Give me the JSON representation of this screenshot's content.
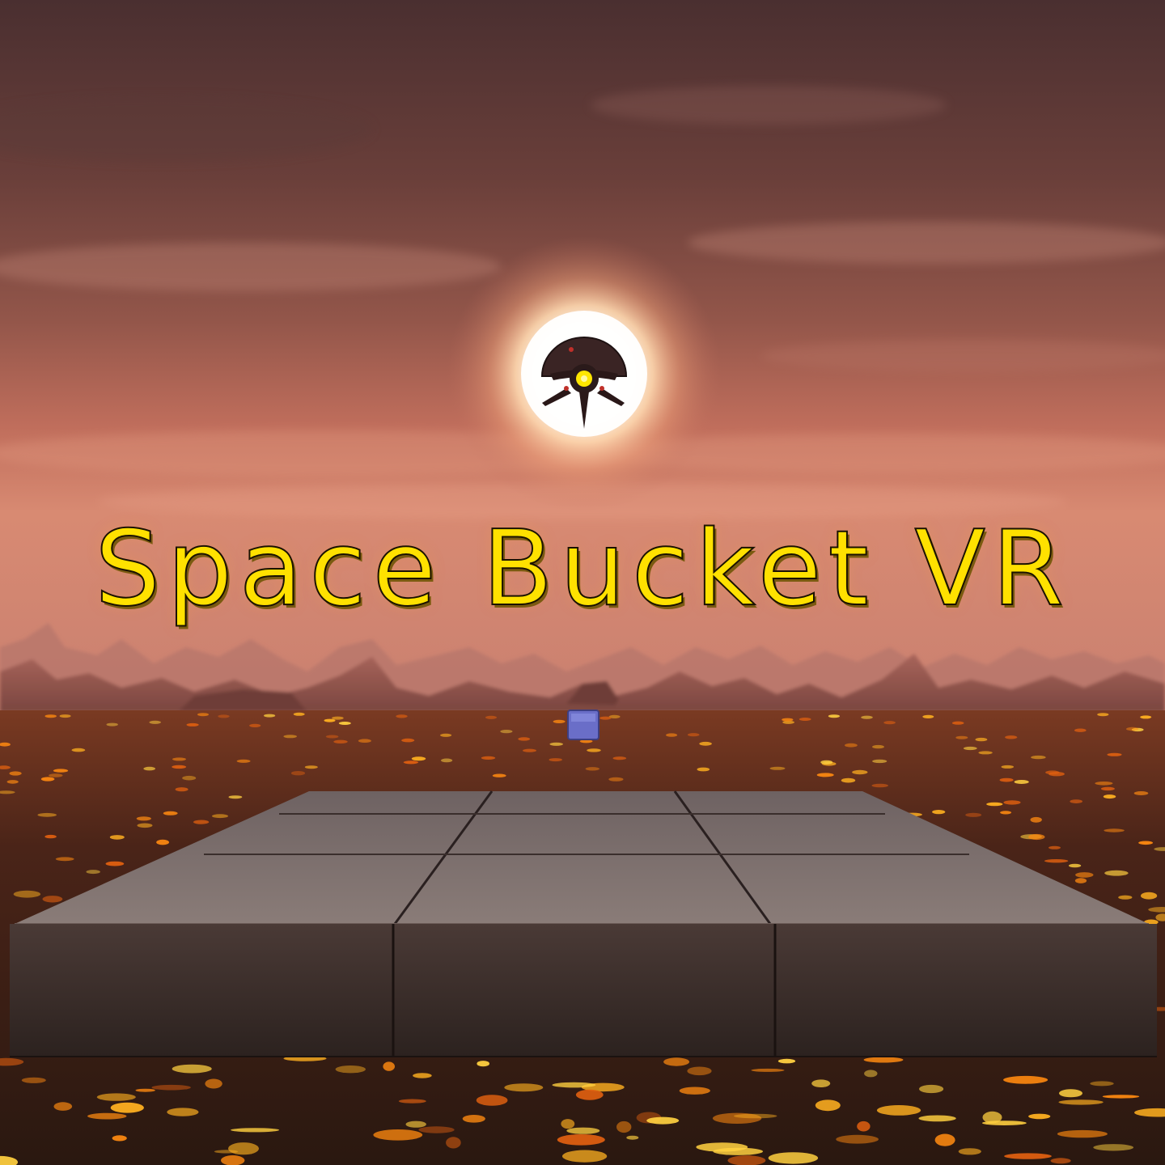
{
  "game": {
    "title": "Space Bucket VR",
    "accent_color": "#ffe100",
    "sky_color": "#b36a5c",
    "lava_color": "#ff9a1a"
  },
  "scene_objects": {
    "sun": "sun-glow",
    "enemy": "alien-drone-icon",
    "target": "blue-cube",
    "platform": "stone-tile-platform"
  }
}
